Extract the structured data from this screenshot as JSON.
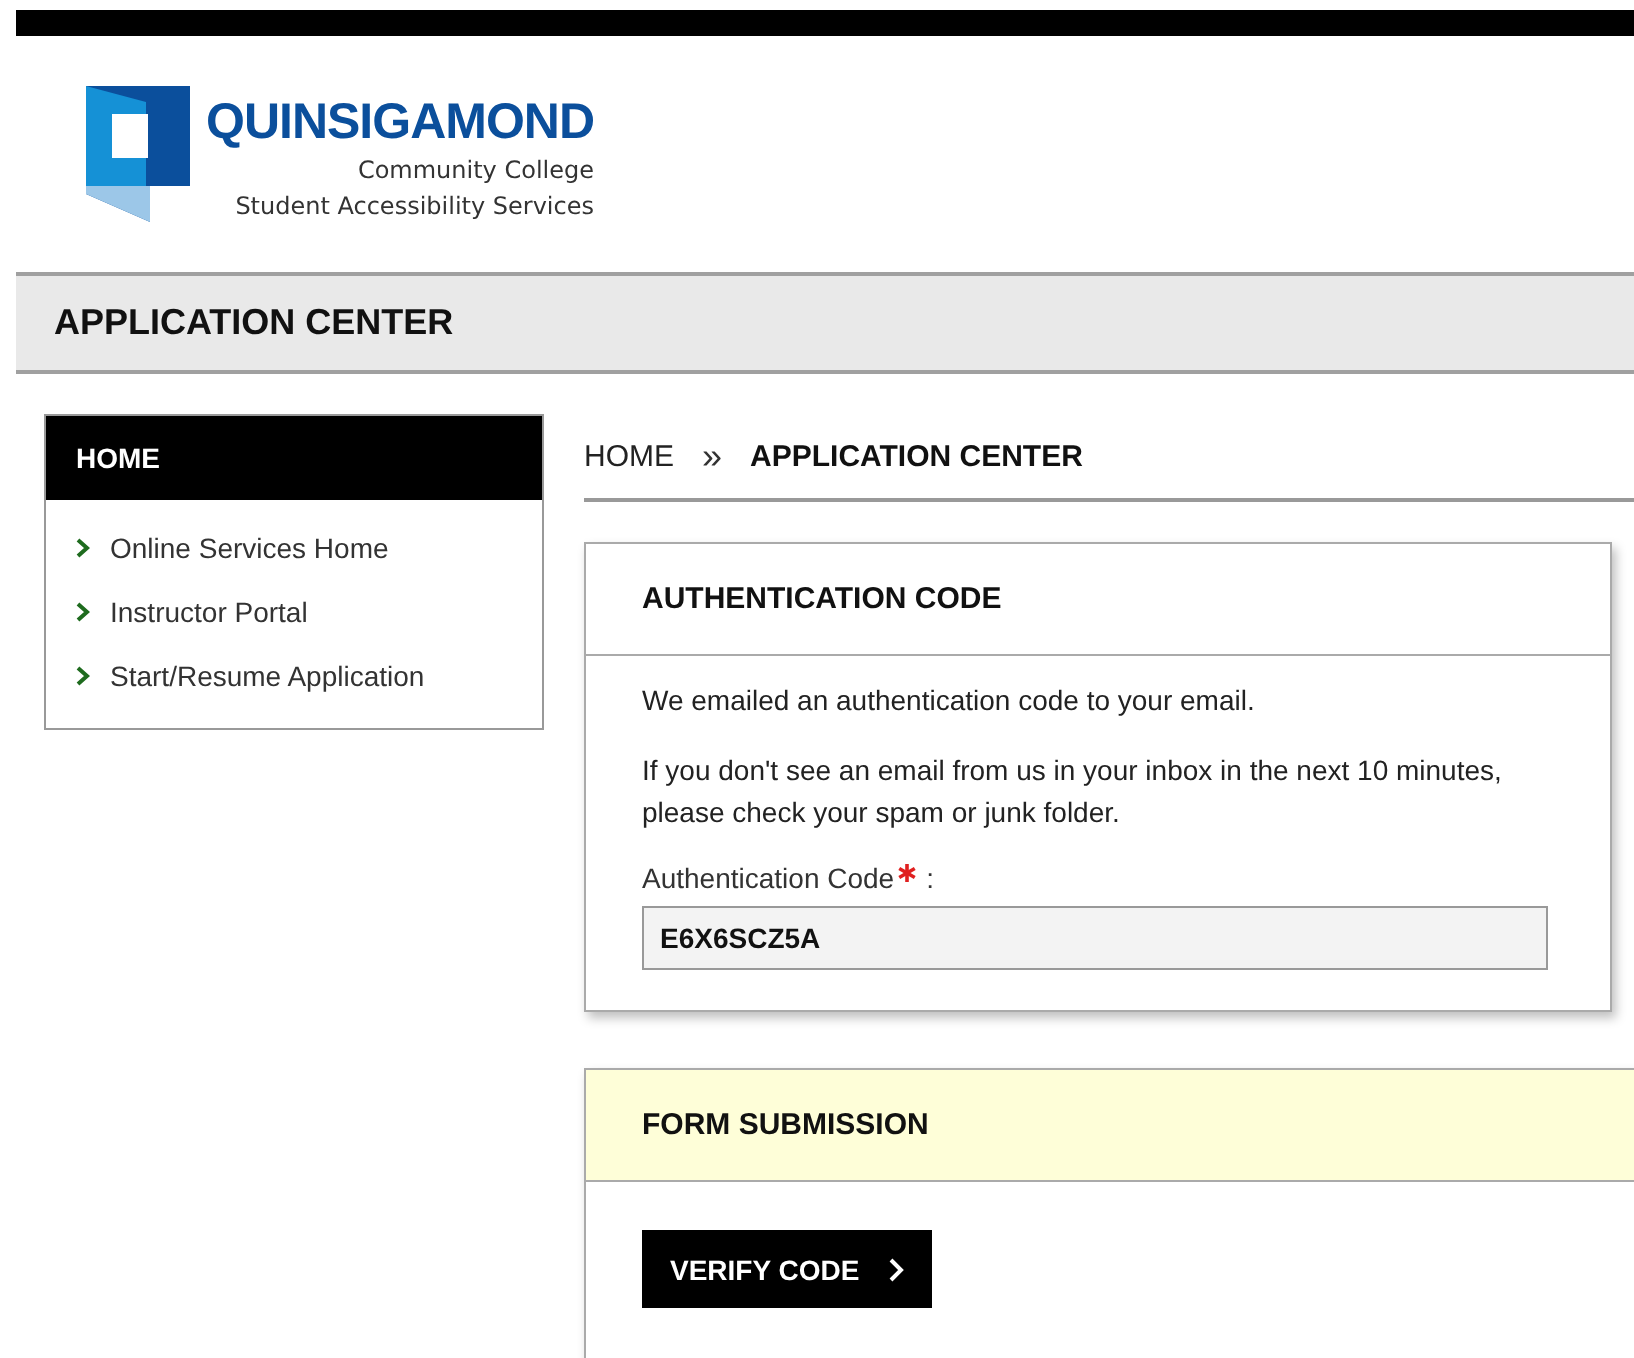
{
  "logo": {
    "name": "QUINSIGAMOND",
    "subtitle": "Community College",
    "department": "Student Accessibility Services"
  },
  "page_header": {
    "title": "APPLICATION CENTER"
  },
  "sidebar": {
    "title": "HOME",
    "items": [
      {
        "label": "Online Services Home"
      },
      {
        "label": "Instructor Portal"
      },
      {
        "label": "Start/Resume Application"
      }
    ]
  },
  "breadcrumb": [
    {
      "label": "HOME",
      "current": false
    },
    {
      "label": "APPLICATION CENTER",
      "current": true
    }
  ],
  "breadcrumb_separator": "»",
  "auth_card": {
    "title": "AUTHENTICATION CODE",
    "message": "We emailed an authentication code to your email.",
    "note": "If you don't see an email from us in your inbox in the next 10 minutes, please check your spam or junk folder.",
    "field_label": "Authentication Code",
    "required": true,
    "label_suffix": ":",
    "field_value": "E6X6SCZ5A"
  },
  "submission_card": {
    "title": "FORM SUBMISSION",
    "button": "VERIFY CODE"
  }
}
